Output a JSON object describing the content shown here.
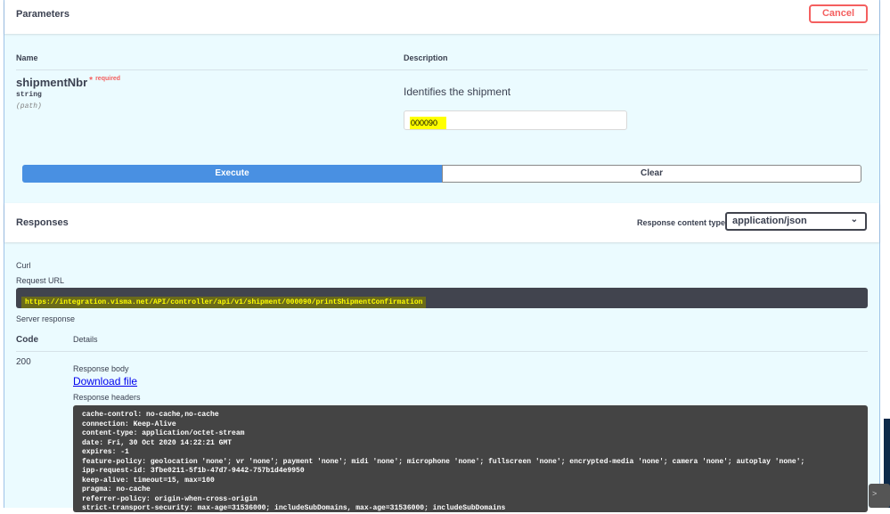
{
  "parameters": {
    "title": "Parameters",
    "cancel_label": "Cancel",
    "col_name": "Name",
    "col_description": "Description",
    "param": {
      "name": "shipmentNbr",
      "star": "*",
      "required": "required",
      "type": "string",
      "in": "(path)",
      "description": "Identifies the shipment",
      "value": "000090"
    },
    "execute_label": "Execute",
    "clear_label": "Clear"
  },
  "responses": {
    "title": "Responses",
    "content_type_label": "Response content type",
    "content_type": "application/json",
    "curl_label": "Curl",
    "request_url_label": "Request URL",
    "request_url": "https://integration.visma.net/API/controller/api/v1/shipment/000090/printShipmentConfirmation",
    "server_response_label": "Server response",
    "col_code": "Code",
    "col_details": "Details",
    "code": "200",
    "response_body_label": "Response body",
    "download_label": "Download file",
    "response_headers_label": "Response headers",
    "headers": "cache-control: no-cache,no-cache\nconnection: Keep-Alive\ncontent-type: application/octet-stream\ndate: Fri, 30 Oct 2020 14:22:21 GMT\nexpires: -1\nfeature-policy: geolocation 'none'; vr 'none'; payment 'none'; midi 'none'; microphone 'none'; fullscreen 'none'; encrypted-media 'none'; camera 'none'; autoplay 'none';\nipp-request-id: 3fbe0211-5f1b-47d7-9442-757b1d4e9950\nkeep-alive: timeout=15, max=100\npragma: no-cache\nreferrer-policy: origin-when-cross-origin\nstrict-transport-security: max-age=31536000; includeSubDomains, max-age=31536000; includeSubDomains"
  },
  "icons": {
    "chevron": "⌄",
    "scroll": ">"
  }
}
